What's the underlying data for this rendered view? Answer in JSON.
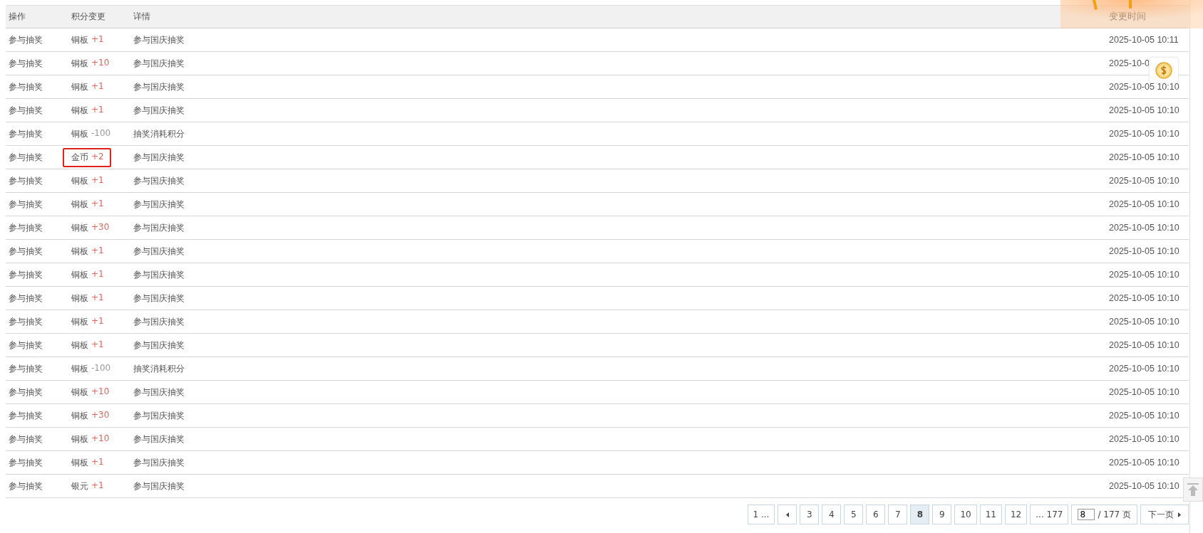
{
  "table": {
    "columns": [
      "操作",
      "积分变更",
      "详情",
      "变更时间"
    ],
    "rows": [
      {
        "action": "参与抽奖",
        "currency": "铜板",
        "amount": "+1",
        "kind": "gain",
        "highlighted": false,
        "detail": "参与国庆抽奖",
        "time": "2025-10-05 10:11"
      },
      {
        "action": "参与抽奖",
        "currency": "铜板",
        "amount": "+10",
        "kind": "gain",
        "highlighted": false,
        "detail": "参与国庆抽奖",
        "time": "2025-10-0"
      },
      {
        "action": "参与抽奖",
        "currency": "铜板",
        "amount": "+1",
        "kind": "gain",
        "highlighted": false,
        "detail": "参与国庆抽奖",
        "time": "2025-10-05 10:10"
      },
      {
        "action": "参与抽奖",
        "currency": "铜板",
        "amount": "+1",
        "kind": "gain",
        "highlighted": false,
        "detail": "参与国庆抽奖",
        "time": "2025-10-05 10:10"
      },
      {
        "action": "参与抽奖",
        "currency": "铜板",
        "amount": "-100",
        "kind": "cost",
        "highlighted": false,
        "detail": "抽奖消耗积分",
        "time": "2025-10-05 10:10"
      },
      {
        "action": "参与抽奖",
        "currency": "金币",
        "amount": "+2",
        "kind": "gain",
        "highlighted": true,
        "detail": "参与国庆抽奖",
        "time": "2025-10-05 10:10"
      },
      {
        "action": "参与抽奖",
        "currency": "铜板",
        "amount": "+1",
        "kind": "gain",
        "highlighted": false,
        "detail": "参与国庆抽奖",
        "time": "2025-10-05 10:10"
      },
      {
        "action": "参与抽奖",
        "currency": "铜板",
        "amount": "+1",
        "kind": "gain",
        "highlighted": false,
        "detail": "参与国庆抽奖",
        "time": "2025-10-05 10:10"
      },
      {
        "action": "参与抽奖",
        "currency": "铜板",
        "amount": "+30",
        "kind": "gain",
        "highlighted": false,
        "detail": "参与国庆抽奖",
        "time": "2025-10-05 10:10"
      },
      {
        "action": "参与抽奖",
        "currency": "铜板",
        "amount": "+1",
        "kind": "gain",
        "highlighted": false,
        "detail": "参与国庆抽奖",
        "time": "2025-10-05 10:10"
      },
      {
        "action": "参与抽奖",
        "currency": "铜板",
        "amount": "+1",
        "kind": "gain",
        "highlighted": false,
        "detail": "参与国庆抽奖",
        "time": "2025-10-05 10:10"
      },
      {
        "action": "参与抽奖",
        "currency": "铜板",
        "amount": "+1",
        "kind": "gain",
        "highlighted": false,
        "detail": "参与国庆抽奖",
        "time": "2025-10-05 10:10"
      },
      {
        "action": "参与抽奖",
        "currency": "铜板",
        "amount": "+1",
        "kind": "gain",
        "highlighted": false,
        "detail": "参与国庆抽奖",
        "time": "2025-10-05 10:10"
      },
      {
        "action": "参与抽奖",
        "currency": "铜板",
        "amount": "+1",
        "kind": "gain",
        "highlighted": false,
        "detail": "参与国庆抽奖",
        "time": "2025-10-05 10:10"
      },
      {
        "action": "参与抽奖",
        "currency": "铜板",
        "amount": "-100",
        "kind": "cost",
        "highlighted": false,
        "detail": "抽奖消耗积分",
        "time": "2025-10-05 10:10"
      },
      {
        "action": "参与抽奖",
        "currency": "铜板",
        "amount": "+10",
        "kind": "gain",
        "highlighted": false,
        "detail": "参与国庆抽奖",
        "time": "2025-10-05 10:10"
      },
      {
        "action": "参与抽奖",
        "currency": "铜板",
        "amount": "+30",
        "kind": "gain",
        "highlighted": false,
        "detail": "参与国庆抽奖",
        "time": "2025-10-05 10:10"
      },
      {
        "action": "参与抽奖",
        "currency": "铜板",
        "amount": "+10",
        "kind": "gain",
        "highlighted": false,
        "detail": "参与国庆抽奖",
        "time": "2025-10-05 10:10"
      },
      {
        "action": "参与抽奖",
        "currency": "铜板",
        "amount": "+1",
        "kind": "gain",
        "highlighted": false,
        "detail": "参与国庆抽奖",
        "time": "2025-10-05 10:10"
      },
      {
        "action": "参与抽奖",
        "currency": "银元",
        "amount": "+1",
        "kind": "gain",
        "highlighted": false,
        "detail": "参与国庆抽奖",
        "time": "2025-10-05 10:10"
      }
    ]
  },
  "pagination": {
    "items": [
      {
        "kind": "page",
        "label": "1 ...",
        "selected": false
      },
      {
        "kind": "prev",
        "selected": false
      },
      {
        "kind": "page",
        "label": "3",
        "selected": false
      },
      {
        "kind": "page",
        "label": "4",
        "selected": false
      },
      {
        "kind": "page",
        "label": "5",
        "selected": false
      },
      {
        "kind": "page",
        "label": "6",
        "selected": false
      },
      {
        "kind": "page",
        "label": "7",
        "selected": false
      },
      {
        "kind": "page",
        "label": "8",
        "selected": true
      },
      {
        "kind": "page",
        "label": "9",
        "selected": false
      },
      {
        "kind": "page",
        "label": "10",
        "selected": false
      },
      {
        "kind": "page",
        "label": "11",
        "selected": false
      },
      {
        "kind": "page",
        "label": "12",
        "selected": false
      },
      {
        "kind": "page",
        "label": "... 177",
        "selected": false
      }
    ],
    "jump": {
      "value": "8",
      "total": "/ 177 页"
    },
    "next": "下一页"
  }
}
